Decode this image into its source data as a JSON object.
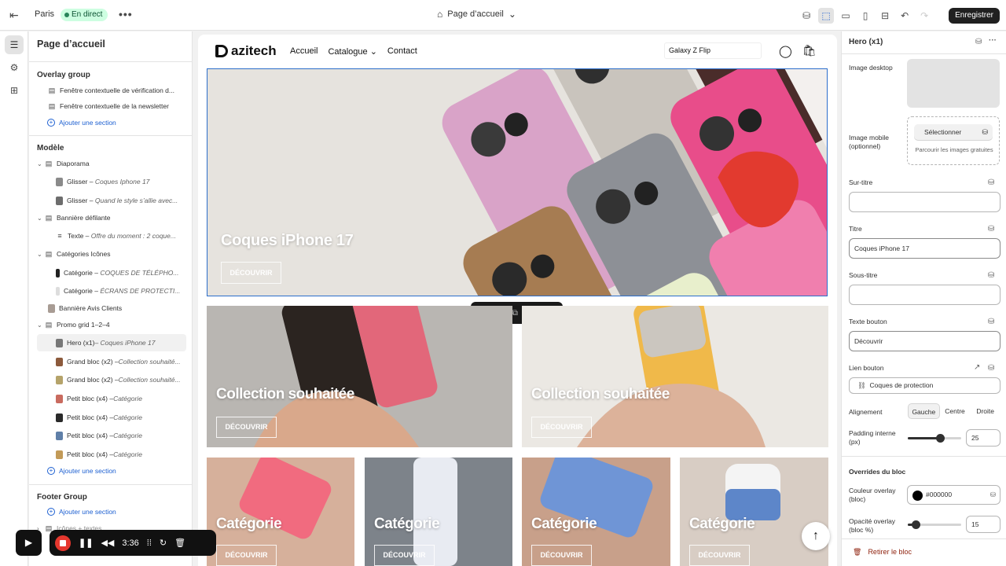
{
  "topbar": {
    "store_name": "Paris",
    "status_badge": "En direct",
    "more": "•••",
    "page_selector": "Page d’accueil",
    "save_label": "Enregistrer"
  },
  "left_panel": {
    "title": "Page d’accueil",
    "overlay_group": {
      "heading": "Overlay group",
      "items": [
        {
          "label": "Fenêtre contextuelle de vérification d..."
        },
        {
          "label": "Fenêtre contextuelle de la newsletter"
        }
      ],
      "add_label": "Ajouter une section"
    },
    "template": {
      "heading": "Modèle",
      "items": [
        {
          "label": "Diaporama",
          "sub": ""
        },
        {
          "label": "Glisser – ",
          "sub": "Coques Iphone 17"
        },
        {
          "label": "Glisser – ",
          "sub": "Quand le style s’allie avec..."
        },
        {
          "label": "Bannière défilante",
          "sub": ""
        },
        {
          "label": "Texte – ",
          "sub": "Offre du moment : 2 coque..."
        },
        {
          "label": "Catégories Icônes",
          "sub": ""
        },
        {
          "label": "Catégorie – ",
          "sub": "COQUES DE TÉLÉPHO..."
        },
        {
          "label": "Catégorie – ",
          "sub": "ÉCRANS DE PROTECTI..."
        },
        {
          "label": "Bannière Avis Clients",
          "sub": ""
        },
        {
          "label": "Promo grid 1–2–4",
          "sub": ""
        },
        {
          "label": "Hero (x1) ",
          "sub": "– Coques iPhone 17"
        },
        {
          "label": "Grand bloc (x2) – ",
          "sub": "Collection souhaité..."
        },
        {
          "label": "Grand bloc (x2) – ",
          "sub": "Collection souhaité..."
        },
        {
          "label": "Petit bloc (x4) – ",
          "sub": "Catégorie"
        },
        {
          "label": "Petit bloc (x4) – ",
          "sub": "Catégorie"
        },
        {
          "label": "Petit bloc (x4) – ",
          "sub": "Catégorie"
        },
        {
          "label": "Petit bloc (x4) – ",
          "sub": "Catégorie"
        }
      ],
      "add_label": "Ajouter une section"
    },
    "footer_group": {
      "heading": "Footer Group",
      "add_label": "Ajouter une section",
      "partial_item": "Icônes + textes"
    }
  },
  "preview": {
    "brand": "azitech",
    "nav": [
      "Accueil",
      "Catalogue",
      "Contact"
    ],
    "search_value": "Galaxy Z Flip",
    "hero": {
      "title": "Coques iPhone 17",
      "button": "DÉCOUVRIR"
    },
    "big_blocks": [
      {
        "title": "Collection souhaitée",
        "button": "DÉCOUVRIR"
      },
      {
        "title": "Collection souhaitée",
        "button": "DÉCOUVRIR"
      }
    ],
    "small_blocks": [
      {
        "title": "Catégorie",
        "button": "DÉCOUVRIR"
      },
      {
        "title": "Catégorie",
        "button": "DÉCOUVRIR"
      },
      {
        "title": "Catégorie",
        "button": "DÉCOUVRIR"
      },
      {
        "title": "Catégorie",
        "button": "DÉCOUVRIR"
      }
    ]
  },
  "right_panel": {
    "title": "Hero (x1)",
    "image_desktop_label": "Image desktop",
    "image_mobile_label": "Image mobile (optionnel)",
    "select_label": "Sélectionner",
    "browse_label": "Parcourir les images gratuites",
    "overline_label": "Sur-titre",
    "overline_value": "",
    "title_label": "Titre",
    "title_value": "Coques iPhone 17",
    "subtitle_label": "Sous-titre",
    "subtitle_value": "",
    "button_text_label": "Texte bouton",
    "button_text_value": "Découvrir",
    "button_link_label": "Lien bouton",
    "button_link_value": "Coques de protection",
    "alignment_label": "Alignement",
    "alignment_options": [
      "Gauche",
      "Centre",
      "Droite"
    ],
    "alignment_selected": "Gauche",
    "padding_label": "Padding interne (px)",
    "padding_value": "25",
    "padding_fraction": 0.6,
    "overrides_heading": "Overrides du bloc",
    "overlay_color_label": "Couleur overlay (bloc)",
    "overlay_color_value": "#000000",
    "overlay_opacity_label": "Opacité overlay (bloc %)",
    "overlay_opacity_value": "15",
    "overlay_opacity_fraction": 0.15,
    "remove_label": "Retirer le bloc"
  },
  "recorder": {
    "time": "3:36"
  },
  "colors": {
    "accent": "#1c5fd1",
    "live_badge_bg": "#cdfee1",
    "save_bg": "#202020",
    "danger": "#8e1f0b"
  }
}
